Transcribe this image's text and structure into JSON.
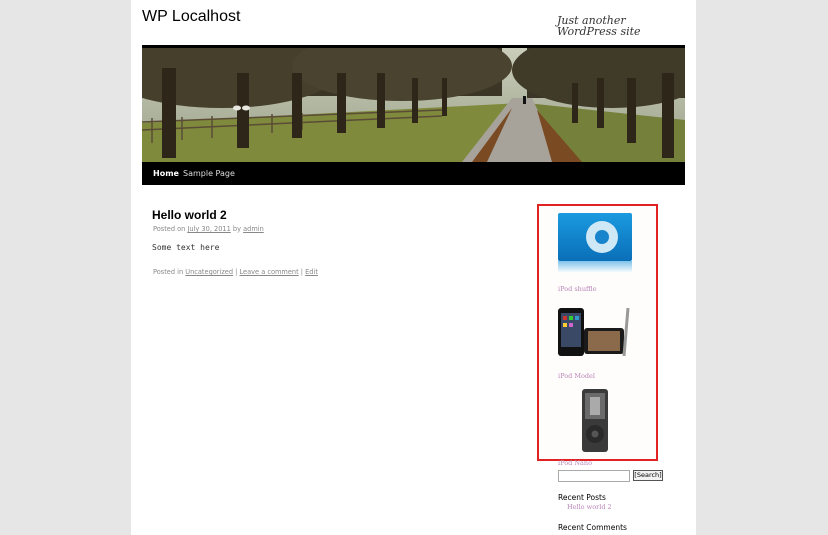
{
  "site": {
    "title": "WP Localhost",
    "tagline": "Just another WordPress site"
  },
  "nav": {
    "items": [
      {
        "label": "Home",
        "current": true
      },
      {
        "label": "Sample Page",
        "current": false
      }
    ]
  },
  "post": {
    "title": "Hello world 2",
    "meta_posted_on": "Posted on",
    "date": "July 30, 2011",
    "meta_by": "by",
    "author": "admin",
    "body": "Some text here",
    "footer_posted_in": "Posted in",
    "category": "Uncategorized",
    "separator": "|",
    "comment_link": "Leave a comment",
    "edit_link": "Edit"
  },
  "sidebar": {
    "products": [
      {
        "label": "iPod shuffle",
        "icon": "ipod-shuffle-image"
      },
      {
        "label": "iPod Model",
        "icon": "ipod-touch-image"
      },
      {
        "label": "iPod Nano",
        "icon": "ipod-nano-image"
      }
    ],
    "search": {
      "value": "",
      "button_label": "[Search]"
    },
    "recent_posts": {
      "title": "Recent Posts",
      "items": [
        "Hello world 2"
      ]
    },
    "recent_comments": {
      "title": "Recent Comments"
    }
  },
  "colors": {
    "highlight_border": "#e02222",
    "link_purple": "#b985b9",
    "nav_background": "#000000"
  }
}
